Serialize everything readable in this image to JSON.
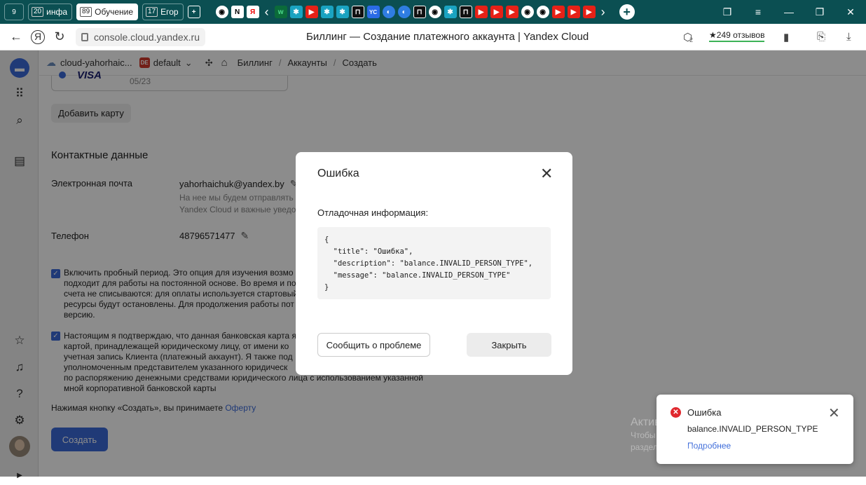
{
  "tabstrip": {
    "groups": [
      {
        "count": "20",
        "label": "инфа"
      },
      {
        "count": "89",
        "label": "Обучение"
      },
      {
        "count": "17",
        "label": "Егор"
      }
    ],
    "home_count": "9",
    "icons": [
      "github-icon",
      "notion-icon",
      "yandex-icon",
      "whatsapp-icon",
      "telegram-icon",
      "youtube-icon",
      "telegram-icon",
      "telegram-icon",
      "notion-icon",
      "yandex-cloud-icon",
      "browser-icon",
      "browser-icon",
      "notion-icon",
      "github-icon",
      "telegram-icon",
      "notion-icon",
      "youtube-icon",
      "youtube-icon",
      "youtube-icon",
      "github-icon",
      "github-icon",
      "youtube-icon",
      "youtube-icon",
      "youtube-icon"
    ]
  },
  "addressbar": {
    "url": "console.cloud.yandex.ru",
    "page_title": "Биллинг — Создание платежного аккаунта | Yandex Cloud",
    "reviews": "249 отзывов",
    "badge_count": "2"
  },
  "breadcrumb": {
    "cloud": "cloud-yahorhaic...",
    "folder_badge": "DE",
    "folder": "default",
    "items": [
      "Биллинг",
      "Аккаунты",
      "Создать"
    ]
  },
  "card": {
    "brand": "VISA",
    "expiry": "05/23"
  },
  "add_card_button": "Добавить карту",
  "contacts": {
    "title": "Контактные данные",
    "email_label": "Электронная почта",
    "email_value": "yahorhaichuk@yandex.by",
    "email_hint_1": "На нее мы будем отправлять",
    "email_hint_2": "Yandex Cloud и важные уведо",
    "phone_label": "Телефон",
    "phone_value": "48796571477"
  },
  "checkboxes": [
    {
      "checked": true,
      "lines": [
        "Включить пробный период. Это опция для изучения возмо",
        "подходит для работы на постоянной основе. Во время и пос",
        "счета не списываются: для оплаты используется стартовый",
        "ресурсы будут остановлены. Для продолжения работы пот",
        "версию."
      ]
    },
    {
      "checked": true,
      "lines": [
        "Настоящим я подтверждаю, что данная банковская карта я",
        "картой, принадлежащей юридическому лицу, от имени ко",
        "учетная запись Клиента (платежный аккаунт). Я также под",
        "уполномоченным представителем указанного юридическ",
        "по распоряжению денежными средствами юридического лица с использованием указанной",
        "мной корпоративной банковской карты"
      ]
    }
  ],
  "accept": {
    "text": "Нажимая кнопку «Создать», вы принимаете ",
    "link": "Оферту"
  },
  "create_button": "Создать",
  "modal": {
    "title": "Ошибка",
    "debug_label": "Отладочная информация:",
    "debug_json": "{\n  \"title\": \"Ошибка\",\n  \"description\": \"balance.INVALID_PERSON_TYPE\",\n  \"message\": \"balance.INVALID_PERSON_TYPE\"\n}",
    "report_button": "Сообщить о проблеме",
    "close_button": "Закрыть"
  },
  "toast": {
    "title": "Ошибка",
    "description": "balance.INVALID_PERSON_TYPE",
    "link": "Подробнее"
  },
  "watermark": {
    "line1": "Активация Windows",
    "line2": "Чтобы активировать Windows, перейдите в",
    "line3": "раздел \"Параметры\"."
  },
  "colors": {
    "accent": "#3b6ad9",
    "tabstrip": "#0b4f52",
    "error": "#e0282e"
  }
}
